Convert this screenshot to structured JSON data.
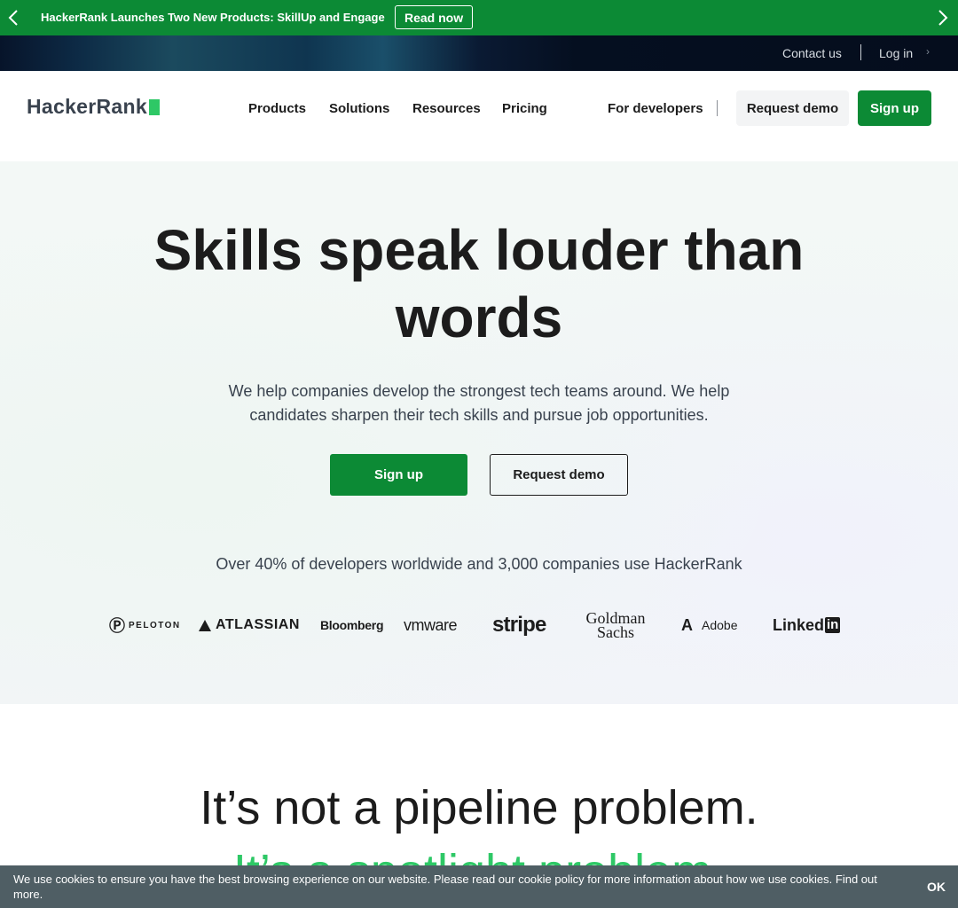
{
  "announcement": {
    "text": "HackerRank Launches Two New Products: SkillUp and Engage",
    "cta_label": "Read now",
    "prev_icon": "chevron-left-icon",
    "next_icon": "chevron-right-icon"
  },
  "utility_bar": {
    "contact_label": "Contact us",
    "login_label": "Log in"
  },
  "nav": {
    "logo_text": "HackerRank",
    "items": [
      {
        "label": "Products"
      },
      {
        "label": "Solutions"
      },
      {
        "label": "Resources"
      },
      {
        "label": "Pricing"
      }
    ],
    "developers_label": "For developers",
    "request_demo_label": "Request demo",
    "signup_label": "Sign up"
  },
  "hero": {
    "title": "Skills speak louder than words",
    "subtitle": "We help companies develop the strongest tech teams around. We help candidates sharpen their tech skills and pursue job opportunities.",
    "signup_label": "Sign up",
    "request_demo_label": "Request demo",
    "trust_text": "Over 40% of developers worldwide and 3,000 companies use HackerRank",
    "logos": {
      "peloton": "PELOTON",
      "atlassian": "ATLASSIAN",
      "bloomberg": "Bloomberg",
      "vmware": "vmware",
      "stripe": "stripe",
      "goldman": "Goldman Sachs",
      "adobe": "Adobe",
      "linkedin_prefix": "Linked",
      "linkedin_box": "in"
    }
  },
  "section2": {
    "title": "It’s not a pipeline problem.",
    "subtitle": "It’s a spotlight problem."
  },
  "cookie": {
    "text": "We use cookies to ensure you have the best browsing experience on our website. Please read our cookie policy for more information about how we use cookies. Find out more.",
    "ok_label": "OK"
  },
  "colors": {
    "brand_green": "#0c8a35",
    "logo_green": "#2ec866",
    "text_dark": "#1c1c1c",
    "cookie_bg": "#4f5e64"
  }
}
